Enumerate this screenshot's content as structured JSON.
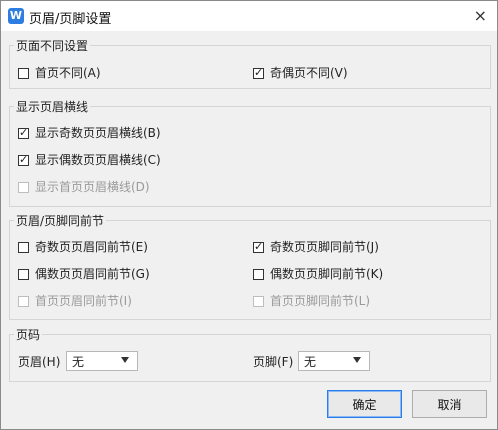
{
  "window": {
    "title": "页眉/页脚设置",
    "close_symbol": "×",
    "app_icon_letter": "W"
  },
  "sections": {
    "page_diff": {
      "title": "页面不同设置",
      "first_page": {
        "label": "首页不同(A)",
        "checked": false,
        "enabled": true
      },
      "odd_even": {
        "label": "奇偶页不同(V)",
        "checked": true,
        "enabled": true
      }
    },
    "header_line": {
      "title": "显示页眉横线",
      "odd": {
        "label": "显示奇数页页眉横线(B)",
        "checked": true,
        "enabled": true
      },
      "even": {
        "label": "显示偶数页页眉横线(C)",
        "checked": true,
        "enabled": true
      },
      "first": {
        "label": "显示首页页眉横线(D)",
        "checked": false,
        "enabled": false
      }
    },
    "same_as_prev": {
      "title": "页眉/页脚同前节",
      "odd_header": {
        "label": "奇数页页眉同前节(E)",
        "checked": false,
        "enabled": true
      },
      "odd_footer": {
        "label": "奇数页页脚同前节(J)",
        "checked": true,
        "enabled": true
      },
      "even_header": {
        "label": "偶数页页眉同前节(G)",
        "checked": false,
        "enabled": true
      },
      "even_footer": {
        "label": "偶数页页脚同前节(K)",
        "checked": false,
        "enabled": true
      },
      "first_header": {
        "label": "首页页眉同前节(I)",
        "checked": false,
        "enabled": false
      },
      "first_footer": {
        "label": "首页页脚同前节(L)",
        "checked": false,
        "enabled": false
      }
    },
    "page_number": {
      "title": "页码",
      "header": {
        "label": "页眉(H)",
        "value": "无"
      },
      "footer": {
        "label": "页脚(F)",
        "value": "无"
      }
    }
  },
  "buttons": {
    "ok": "确定",
    "cancel": "取消"
  },
  "colors": {
    "accent": "#2b7de9",
    "dialog_bg": "#f0f0f0",
    "disabled_text": "#9a9a9a"
  }
}
